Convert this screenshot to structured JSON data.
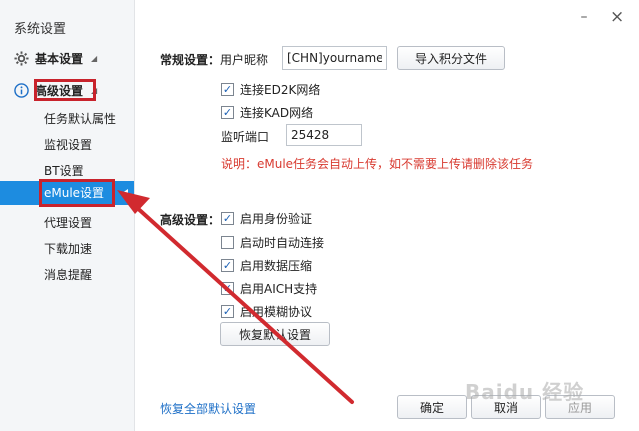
{
  "window": {
    "title": "系统设置",
    "minimize_glyph": "–",
    "close_glyph": "×"
  },
  "sidebar": {
    "groups": [
      {
        "label": "基本设置",
        "icon": "gear-icon"
      },
      {
        "label": "高级设置",
        "icon": "info-icon"
      }
    ],
    "items": [
      {
        "label": "任务默认属性"
      },
      {
        "label": "监视设置"
      },
      {
        "label": "BT设置"
      },
      {
        "label": "eMule设置"
      },
      {
        "label": "代理设置"
      },
      {
        "label": "下载加速"
      },
      {
        "label": "消息提醒"
      }
    ],
    "selected": "eMule设置"
  },
  "general": {
    "section_label": "常规设置：",
    "nickname_label": "用户昵称",
    "nickname_value": "[CHN]yourname",
    "import_button": "导入积分文件",
    "checkboxes": [
      {
        "label": "连接ED2K网络",
        "checked": true
      },
      {
        "label": "连接KAD网络",
        "checked": true
      }
    ],
    "port_label": "监听端口",
    "port_value": "25428",
    "note": "说明：eMule任务会自动上传，如不需要上传请删除该任务"
  },
  "advanced": {
    "section_label": "高级设置：",
    "checkboxes": [
      {
        "label": "启用身份验证",
        "checked": true
      },
      {
        "label": "启动时自动连接",
        "checked": false
      },
      {
        "label": "启用数据压缩",
        "checked": true
      },
      {
        "label": "启用AICH支持",
        "checked": true
      },
      {
        "label": "启用模糊协议",
        "checked": true
      }
    ],
    "restore_button": "恢复默认设置"
  },
  "footer": {
    "restore_all_link": "恢复全部默认设置",
    "ok_button": "确定",
    "cancel_button": "取消",
    "apply_button": "应用"
  },
  "watermark": "Baidu 经验",
  "colors": {
    "accent": "#1d8ce0",
    "annotation_red": "#c8232c",
    "note_red": "#d83a30",
    "link_blue": "#1d6fc7"
  }
}
